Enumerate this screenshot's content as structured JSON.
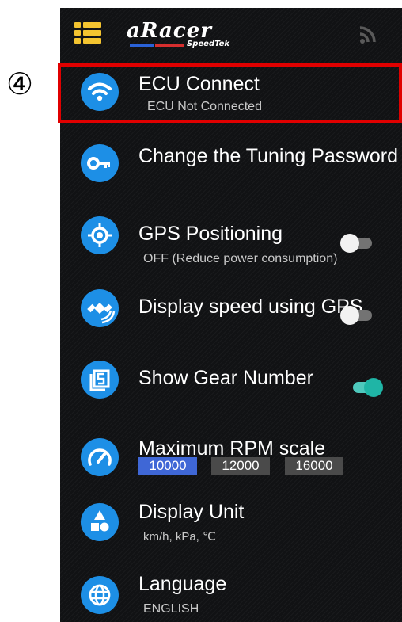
{
  "annotation": {
    "marker": "④"
  },
  "header": {
    "logo": {
      "brand": "aRacer",
      "sub": "SpeedTek"
    }
  },
  "menu": [
    {
      "icon": "wifi-icon",
      "title": "ECU Connect",
      "subtitle": "ECU Not Connected"
    },
    {
      "icon": "key-icon",
      "title": "Change the Tuning Password"
    },
    {
      "icon": "gps-icon",
      "title": "GPS Positioning",
      "subtitle": "OFF (Reduce power consumption)",
      "toggle": false
    },
    {
      "icon": "satellite-icon",
      "title": "Display speed using GPS",
      "toggle": false
    },
    {
      "icon": "gear-number-icon",
      "title": "Show Gear Number",
      "toggle": true
    },
    {
      "icon": "speedometer-icon",
      "title": "Maximum RPM scale",
      "options": [
        "10000",
        "12000",
        "16000"
      ],
      "selected": "10000"
    },
    {
      "icon": "shapes-icon",
      "title": "Display Unit",
      "subtitle": "km/h, kPa, ℃"
    },
    {
      "icon": "globe-icon",
      "title": "Language",
      "subtitle": "ENGLISH"
    }
  ],
  "colors": {
    "accent": "#1d8fe6",
    "toggle_on": "#1fb5a6",
    "highlight": "#e00000",
    "rpm_selected": "#3f67d6",
    "menu_icon": "#f4c430"
  }
}
